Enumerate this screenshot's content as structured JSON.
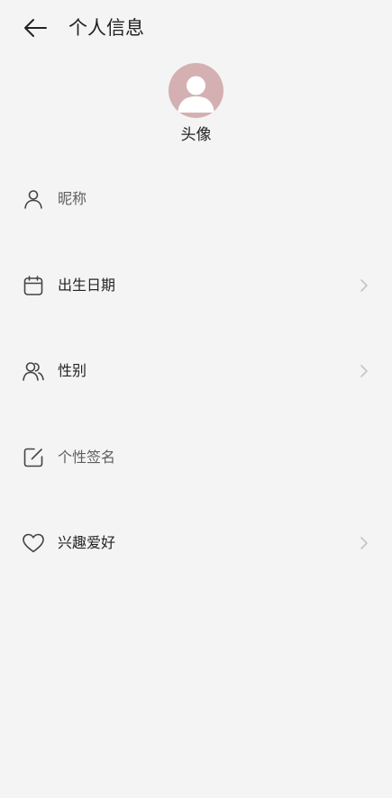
{
  "header": {
    "title": "个人信息",
    "back_icon": "arrow-left-icon"
  },
  "avatar": {
    "label": "头像",
    "color": "#d4b0b2"
  },
  "rows": [
    {
      "label": "昵称",
      "icon": "user-icon",
      "chevron": false
    },
    {
      "label": "出生日期",
      "icon": "calendar-icon",
      "chevron": true
    },
    {
      "label": "性别",
      "icon": "users-icon",
      "chevron": true
    },
    {
      "label": "个性签名",
      "icon": "edit-icon",
      "chevron": false
    },
    {
      "label": "兴趣爱好",
      "icon": "heart-icon",
      "chevron": true
    }
  ]
}
